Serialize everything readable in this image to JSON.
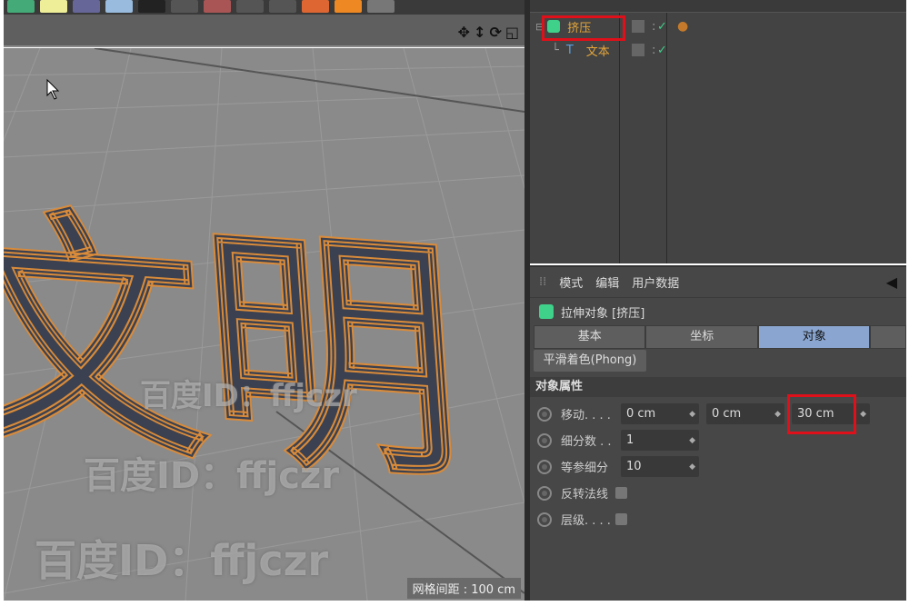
{
  "viewport": {
    "grid_spacing": "网格间距 : 100 cm",
    "model_text": "文明",
    "watermarks": [
      "百度ID：ffjczr",
      "百度ID：ffjczr",
      "百度ID：ffjczr"
    ]
  },
  "object_manager": {
    "objects": [
      {
        "name": "挤压",
        "icon": "extrude-icon",
        "selected": true
      },
      {
        "name": "文本",
        "icon": "text-spline-icon",
        "child": true
      }
    ]
  },
  "attribute_manager": {
    "menu": [
      "模式",
      "编辑",
      "用户数据"
    ],
    "title": "拉伸对象 [挤压]",
    "tabs": [
      "基本",
      "坐标",
      "对象"
    ],
    "active_tab": "对象",
    "subtab": "平滑着色(Phong)",
    "section": "对象属性",
    "props": {
      "move_label": "移动. . . .",
      "move": [
        "0 cm",
        "0 cm",
        "30 cm"
      ],
      "subdiv_label": "细分数 . .",
      "subdiv": "1",
      "iso_label": "等参细分",
      "iso": "10",
      "flip_label": "反转法线",
      "hier_label": "层级. . . ."
    }
  },
  "colors": {
    "highlight": "#e0101a",
    "active_tab": "#8aa6d0",
    "object_name": "#e5a63b"
  }
}
